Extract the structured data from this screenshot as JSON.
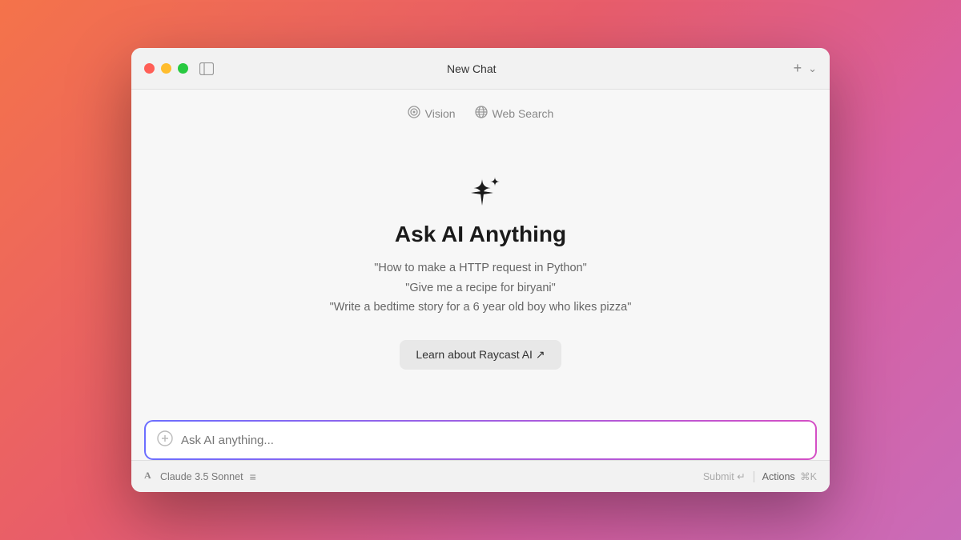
{
  "window": {
    "title": "New Chat"
  },
  "toolbar": {
    "vision_label": "Vision",
    "websearch_label": "Web Search",
    "add_label": "+",
    "chevron_label": "⌄"
  },
  "hero": {
    "title": "Ask AI Anything",
    "example1": "\"How to make a HTTP request in Python\"",
    "example2": "\"Give me a recipe for biryani\"",
    "example3": "\"Write a bedtime story for a 6 year old boy who likes pizza\"",
    "learn_btn": "Learn about Raycast AI ↗"
  },
  "input": {
    "placeholder": "Ask AI anything..."
  },
  "statusbar": {
    "model_icon": "A",
    "model_name": "Claude 3.5 Sonnet",
    "menu_icon": "≡",
    "submit_label": "Submit ↵",
    "divider": "|",
    "actions_label": "Actions",
    "actions_shortcut": "⌘K"
  }
}
